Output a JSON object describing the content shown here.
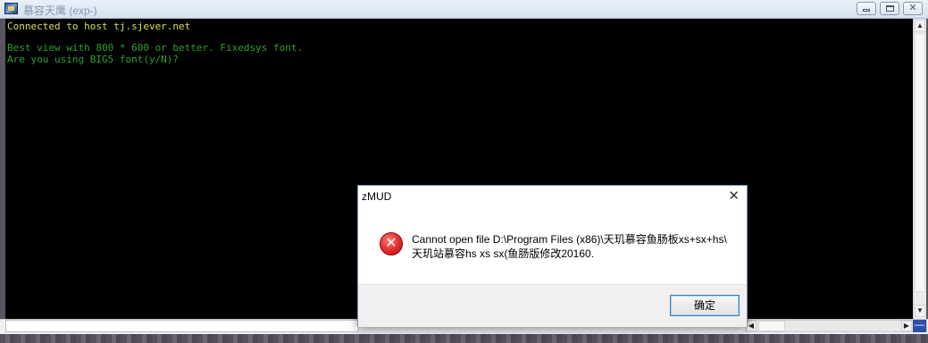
{
  "window": {
    "title": "慕容天鹰 (exp-)",
    "buttons": {
      "minimize_icon": "minimize-icon",
      "maximize_icon": "maximize-icon",
      "close_label": "✕"
    }
  },
  "terminal": {
    "lines": [
      "Connected to host tj.sjever.net",
      "Best view with 800 * 600 or better. Fixedsys font.",
      "Are you using BIG5 font(y/N)?"
    ]
  },
  "scrollbar": {
    "up": "▲",
    "down": "▼"
  },
  "hscroll": {
    "left": "◀",
    "right": "▶",
    "minus": "—"
  },
  "dialog": {
    "title": "zMUD",
    "close": "✕",
    "icon": "error-icon",
    "icon_glyph": "✕",
    "message_line1": "Cannot open file D:\\Program Files (x86)\\天玑慕容鱼肠板xs+sx+hs\\",
    "message_line2": "天玑站慕容hs xs sx(鱼肠版修改20160.",
    "ok_label": "确定"
  }
}
